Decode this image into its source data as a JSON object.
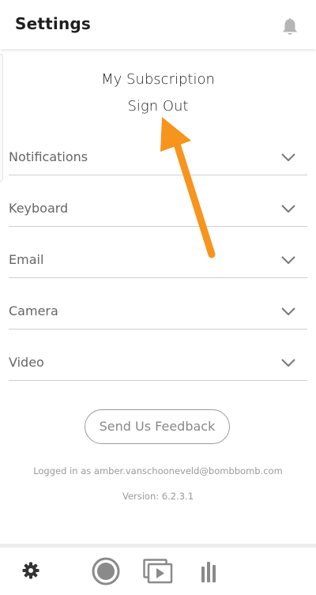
{
  "header": {
    "title": "Settings",
    "notification_icon": "bell-icon"
  },
  "menu": {
    "subscription": "My Subscription",
    "sign_out": "Sign Out"
  },
  "sections": [
    {
      "label": "Notifications",
      "icon": "chevron-down-icon"
    },
    {
      "label": "Keyboard",
      "icon": "chevron-down-icon"
    },
    {
      "label": "Email",
      "icon": "chevron-down-icon"
    },
    {
      "label": "Camera",
      "icon": "chevron-down-icon"
    },
    {
      "label": "Video",
      "icon": "chevron-down-icon"
    }
  ],
  "feedback": {
    "label": "Send Us Feedback"
  },
  "footer": {
    "logged_in": "Logged in as amber.vanschooneveld@bombbomb.com",
    "version": "Version: 6.2.3.1"
  },
  "tabbar": {
    "items": [
      {
        "icon": "gear-icon",
        "active": true
      },
      {
        "icon": "record-icon",
        "active": false
      },
      {
        "icon": "video-library-icon",
        "active": false
      },
      {
        "icon": "analytics-icon",
        "active": false
      }
    ]
  },
  "colors": {
    "annotation_arrow": "#F7941D",
    "icon_gray": "#888888",
    "text_dark": "#222222"
  }
}
